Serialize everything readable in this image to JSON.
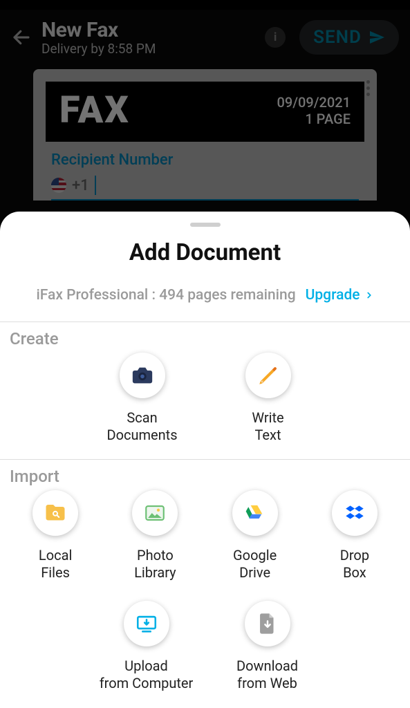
{
  "header": {
    "title": "New Fax",
    "subtitle": "Delivery by 8:58 PM",
    "send_label": "SEND"
  },
  "fax_preview": {
    "banner_word": "FAX",
    "date": "09/09/2021",
    "pages_label": "1 PAGE",
    "recipient_label": "Recipient Number",
    "dial_prefix": "+1"
  },
  "sheet": {
    "title": "Add Document",
    "subtitle": "iFax Professional : 494 pages remaining",
    "upgrade_label": "Upgrade",
    "sections": {
      "create": {
        "label": "Create",
        "items": [
          {
            "label": "Scan\nDocuments"
          },
          {
            "label": "Write\nText"
          }
        ]
      },
      "import": {
        "label": "Import",
        "items_row1": [
          {
            "label": "Local\nFiles"
          },
          {
            "label": "Photo\nLibrary"
          },
          {
            "label": "Google\nDrive"
          },
          {
            "label": "Drop\nBox"
          }
        ],
        "items_row2": [
          {
            "label": "Upload\nfrom Computer"
          },
          {
            "label": "Download\nfrom Web"
          }
        ]
      }
    }
  }
}
